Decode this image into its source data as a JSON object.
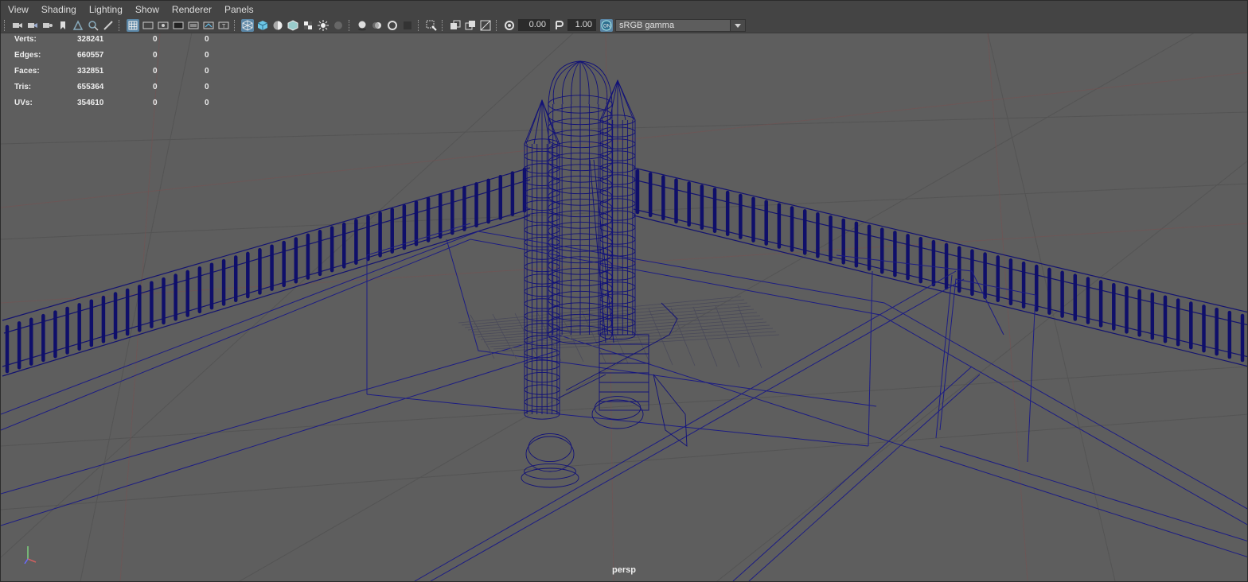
{
  "menu": [
    "View",
    "Shading",
    "Lighting",
    "Show",
    "Renderer",
    "Panels"
  ],
  "toolbar": {
    "exposure": "0.00",
    "gamma": "1.00",
    "color_space": "sRGB gamma"
  },
  "hud": {
    "rows": [
      {
        "label": "Verts:",
        "value": "328241",
        "sel": "0",
        "uv": "0"
      },
      {
        "label": "Edges:",
        "value": "660557",
        "sel": "0",
        "uv": "0"
      },
      {
        "label": "Faces:",
        "value": "332851",
        "sel": "0",
        "uv": "0"
      },
      {
        "label": "Tris:",
        "value": "655364",
        "sel": "0",
        "uv": "0"
      },
      {
        "label": "UVs:",
        "value": "354610",
        "sel": "0",
        "uv": "0"
      }
    ]
  },
  "viewport": {
    "camera": "persp",
    "wire_color": "#1a1a80",
    "bg_color": "#5e5e5e"
  },
  "icons": [
    "camera-icon",
    "camera-attributes-icon",
    "bookmark-icon",
    "grid-icon",
    "wireframe-icon",
    "smooth-shade-icon",
    "textured-icon",
    "lights-icon",
    "shadows-icon",
    "xray-icon",
    "isolate-icon",
    "exposure-icon",
    "gamma-icon",
    "color-management-icon"
  ]
}
